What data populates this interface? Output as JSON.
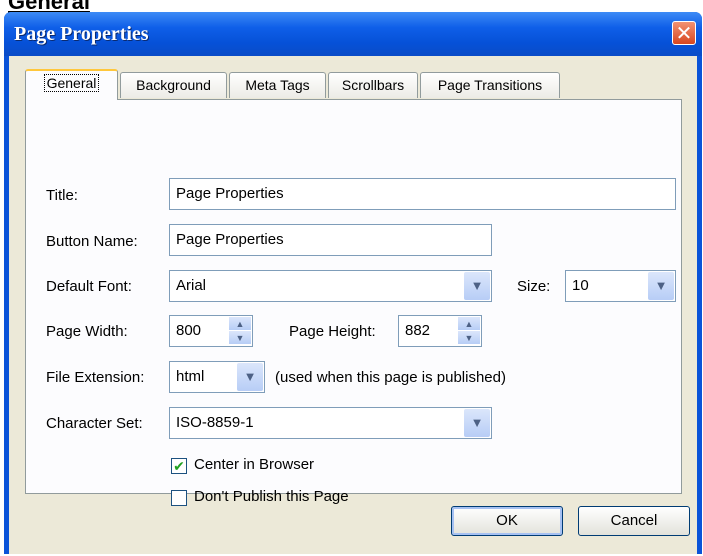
{
  "page_heading": "General",
  "dialog": {
    "title": "Page Properties",
    "close_glyph": "✕"
  },
  "tabs": [
    {
      "label": "General",
      "active": true
    },
    {
      "label": "Background",
      "active": false
    },
    {
      "label": "Meta Tags",
      "active": false
    },
    {
      "label": "Scrollbars",
      "active": false
    },
    {
      "label": "Page Transitions",
      "active": false
    }
  ],
  "form": {
    "title": {
      "label": "Title:",
      "value": "Page Properties"
    },
    "button_name": {
      "label": "Button Name:",
      "value": "Page Properties"
    },
    "default_font": {
      "label": "Default Font:",
      "value": "Arial"
    },
    "size": {
      "label": "Size:",
      "value": "10"
    },
    "page_width": {
      "label": "Page Width:",
      "value": "800"
    },
    "page_height": {
      "label": "Page Height:",
      "value": "882"
    },
    "file_extension": {
      "label": "File Extension:",
      "value": "html",
      "note": "(used when this page is published)"
    },
    "character_set": {
      "label": "Character Set:",
      "value": "ISO-8859-1"
    },
    "center_in_browser": {
      "label": "Center in Browser",
      "checked": true
    },
    "dont_publish": {
      "label": "Don't Publish this Page",
      "checked": false
    }
  },
  "buttons": {
    "ok": "OK",
    "cancel": "Cancel"
  },
  "icons": {
    "dropdown": "▼",
    "spin_up": "▲",
    "spin_down": "▼",
    "check": "✔"
  },
  "colors": {
    "titlebar": "#0a53d8",
    "dialog_face": "#ece9d8",
    "close_button": "#d8461f",
    "active_tab_highlight": "#ffc73c"
  }
}
